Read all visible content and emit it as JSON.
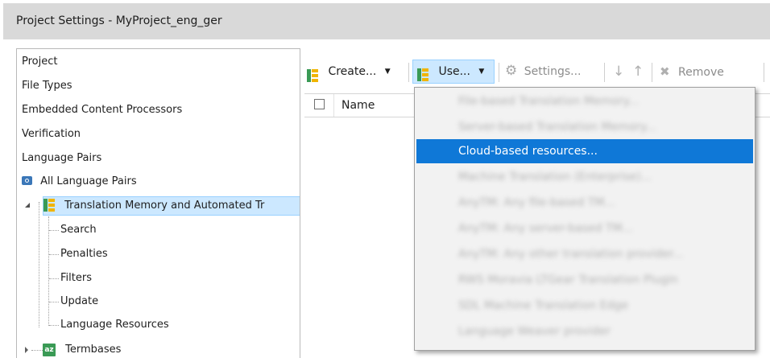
{
  "window": {
    "title": "Project Settings - MyProject_eng_ger"
  },
  "tree": {
    "items": [
      {
        "label": "Project"
      },
      {
        "label": "File Types"
      },
      {
        "label": "Embedded Content Processors"
      },
      {
        "label": "Verification"
      },
      {
        "label": "Language Pairs"
      },
      {
        "label": "All Language Pairs"
      },
      {
        "label": "Translation Memory and Automated Tr"
      },
      {
        "label": "Search"
      },
      {
        "label": "Penalties"
      },
      {
        "label": "Filters"
      },
      {
        "label": "Update"
      },
      {
        "label": "Language Resources"
      },
      {
        "label": "Termbases"
      }
    ]
  },
  "toolbar": {
    "create_label": "Create...",
    "use_label": "Use...",
    "settings_label": "Settings...",
    "remove_label": "Remove"
  },
  "grid": {
    "name_header": "Name"
  },
  "dropdown": {
    "items": [
      {
        "label": "File-based Translation Memory...",
        "state": "blurred"
      },
      {
        "label": "Server-based Translation Memory...",
        "state": "blurred"
      },
      {
        "label": "Cloud-based resources...",
        "state": "highlighted"
      },
      {
        "label": "Machine Translation (Enterprise)...",
        "state": "blurred"
      },
      {
        "label": "AnyTM: Any file-based TM...",
        "state": "blurred"
      },
      {
        "label": "AnyTM: Any server-based TM...",
        "state": "blurred"
      },
      {
        "label": "AnyTM: Any other translation provider...",
        "state": "blurred"
      },
      {
        "label": "RWS Moravia LTGear Translation Plugin",
        "state": "blurred"
      },
      {
        "label": "SDL Machine Translation Edge",
        "state": "blurred"
      },
      {
        "label": "Language Weaver provider",
        "state": "blurred"
      }
    ]
  },
  "colors": {
    "titlebar_bg": "#d9d9d9",
    "selection_bg": "#cce8ff",
    "menu_highlight": "#0f78d7"
  }
}
